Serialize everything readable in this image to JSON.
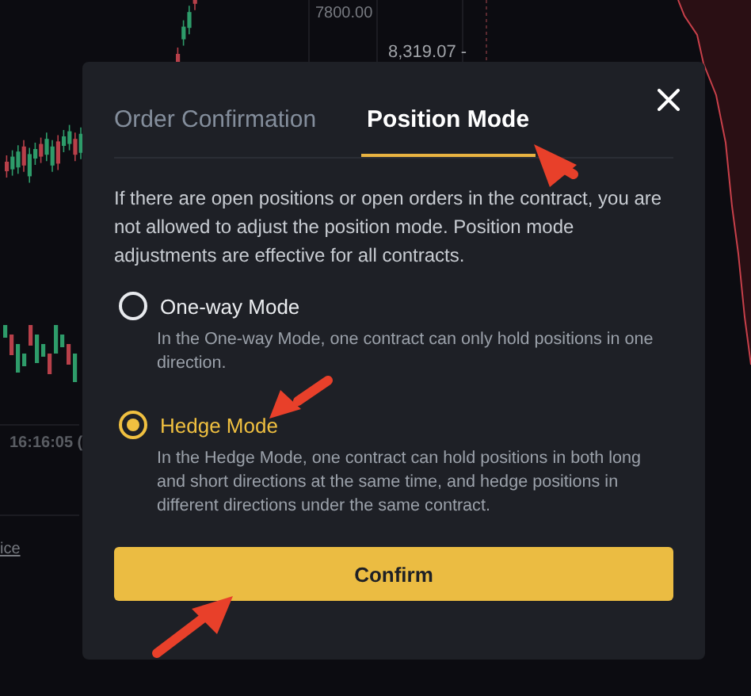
{
  "background": {
    "price_label": "7800.00",
    "last_price": "8,319.07 -",
    "time_label": "16:16:05 (",
    "link": "ice"
  },
  "dialog": {
    "tabs": [
      {
        "label": "Order Confirmation",
        "selected": false
      },
      {
        "label": "Position Mode",
        "selected": true
      }
    ],
    "notice": "If there are open positions or open orders in the contract, you are not allowed to adjust the position mode. Position mode adjustments are effective for all contracts.",
    "options": [
      {
        "label": "One-way Mode",
        "description": "In the One-way Mode, one contract can only hold positions in one direction.",
        "selected": false
      },
      {
        "label": "Hedge Mode",
        "description": "In the Hedge Mode, one contract can hold positions in both long and short directions at the same time, and hedge positions in different directions under the same contract.",
        "selected": true
      }
    ],
    "confirm_button": "Confirm"
  }
}
